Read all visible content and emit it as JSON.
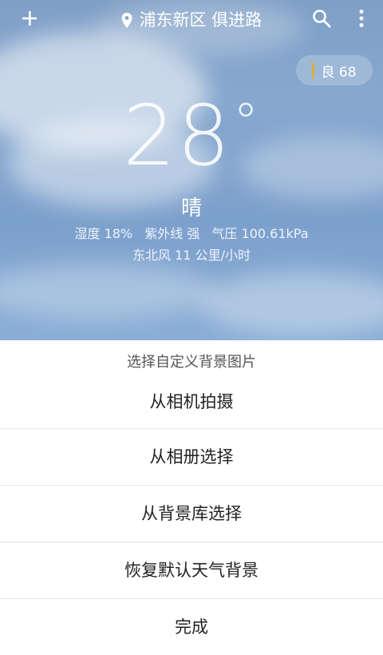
{
  "header": {
    "location": "浦东新区 俱进路",
    "icons": {
      "add": "plus-icon",
      "location": "location-pin-icon",
      "search": "search-icon",
      "more": "more-vertical-icon"
    }
  },
  "aqi": {
    "label": "良 68",
    "indicator_color": "#d6b23c"
  },
  "weather": {
    "temperature": "28",
    "degree_symbol": "°",
    "condition": "晴",
    "humidity": "湿度 18%",
    "uv": "紫外线 强",
    "pressure": "气压 100.61kPa",
    "wind": "东北风 11 公里/小时"
  },
  "sheet": {
    "title": "选择自定义背景图片",
    "items": [
      "从相机拍摄",
      "从相册选择",
      "从背景库选择",
      "恢复默认天气背景",
      "完成"
    ]
  }
}
